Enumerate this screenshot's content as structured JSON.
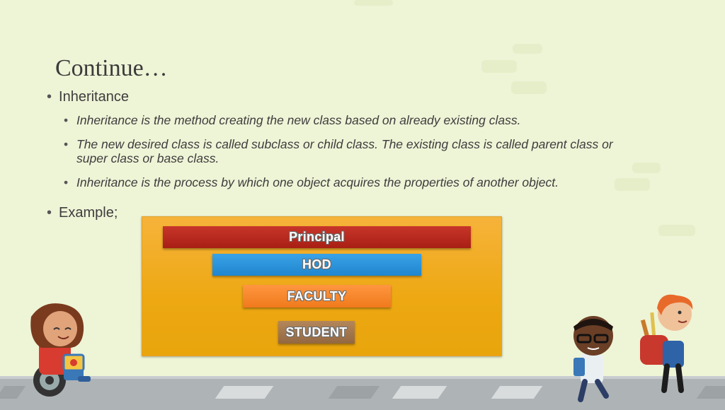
{
  "title": "Continue…",
  "bullets": {
    "inheritance": "Inheritance",
    "sub_points": [
      "Inheritance is the method creating the new class based on already existing class.",
      "The new desired class is called subclass or child class. The existing class is called parent class or super class or base class.",
      "Inheritance is the process by which one object acquires the properties of another object."
    ],
    "example": "Example;"
  },
  "diagram": {
    "levels": [
      "Principal",
      "HOD",
      "FACULTY",
      "STUDENT"
    ]
  },
  "colors": {
    "background": "#eef4d6",
    "diagram_bg": "#eda812",
    "principal": "#b3261b",
    "hod": "#2c94db",
    "faculty": "#f5862e",
    "student": "#a3774e"
  }
}
